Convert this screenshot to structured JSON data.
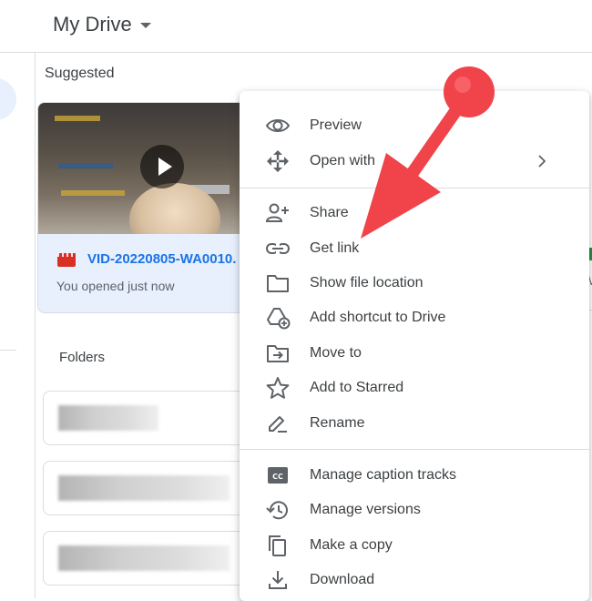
{
  "header": {
    "title": "My Drive"
  },
  "suggested": {
    "heading": "Suggested",
    "card": {
      "file_name": "VID-20220805-WA0010.",
      "subtitle": "You opened just now"
    }
  },
  "folders": {
    "heading": "Folders",
    "count": 3
  },
  "context_menu": {
    "items": [
      {
        "label": "Preview",
        "icon": "eye-icon"
      },
      {
        "label": "Open with",
        "icon": "move-arrows-icon",
        "has_submenu": true
      },
      {
        "label": "Share",
        "icon": "person-add-icon"
      },
      {
        "label": "Get link",
        "icon": "link-icon"
      },
      {
        "label": "Show file location",
        "icon": "folder-icon"
      },
      {
        "label": "Add shortcut to Drive",
        "icon": "drive-shortcut-icon"
      },
      {
        "label": "Move to",
        "icon": "move-to-folder-icon"
      },
      {
        "label": "Add to Starred",
        "icon": "star-icon"
      },
      {
        "label": "Rename",
        "icon": "pencil-icon"
      },
      {
        "label": "Manage caption tracks",
        "icon": "closed-caption-icon"
      },
      {
        "label": "Manage versions",
        "icon": "history-icon"
      },
      {
        "label": "Make a copy",
        "icon": "copy-icon"
      },
      {
        "label": "Download",
        "icon": "download-icon"
      }
    ]
  },
  "right_edge": {
    "text": "W"
  },
  "colors": {
    "accent": "#1a73e8",
    "annotation_arrow": "#f0434a",
    "card_bg": "#e8f0fe",
    "video_icon": "#d93025"
  }
}
